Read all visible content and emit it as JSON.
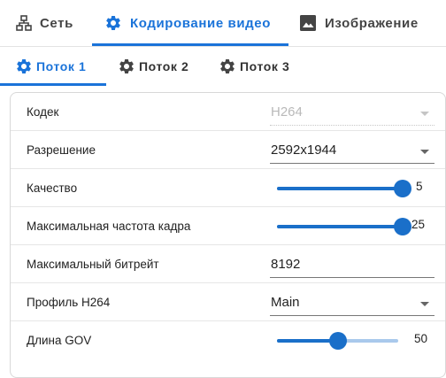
{
  "top_tabs": [
    {
      "label": "Сеть",
      "icon": "network-icon",
      "active": false
    },
    {
      "label": "Кодирование видео",
      "icon": "gear-icon",
      "active": true
    },
    {
      "label": "Изображение",
      "icon": "image-icon",
      "active": false
    }
  ],
  "sub_tabs": [
    {
      "label": "Поток 1",
      "icon": "gear-icon",
      "active": true
    },
    {
      "label": "Поток 2",
      "icon": "gear-icon",
      "active": false
    },
    {
      "label": "Поток 3",
      "icon": "gear-icon",
      "active": false
    }
  ],
  "settings": {
    "codec": {
      "label": "Кодек",
      "value": "H264",
      "disabled": true
    },
    "resolution": {
      "label": "Разрешение",
      "value": "2592x1944"
    },
    "quality": {
      "label": "Качество",
      "value": "5",
      "min": 1,
      "max": 5
    },
    "max_framerate": {
      "label": "Максимальная частота кадра",
      "value": "25",
      "min": 1,
      "max": 25
    },
    "max_bitrate": {
      "label": "Максимальный битрейт",
      "value": "8192"
    },
    "h264_profile": {
      "label": "Профиль H264",
      "value": "Main"
    },
    "gov_length": {
      "label": "Длина GOV",
      "value": "50",
      "fraction": 0.5
    }
  },
  "colors": {
    "accent": "#1a73d9",
    "slider_active": "#1a6fc9",
    "slider_track": "#a9c9ec"
  }
}
